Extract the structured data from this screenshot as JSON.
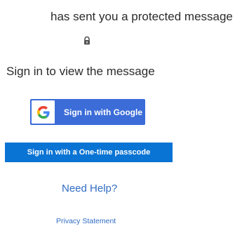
{
  "header": {
    "message": "has sent you a protected message",
    "lock_icon": "lock-icon"
  },
  "main": {
    "heading": "Sign in to view the message",
    "google_button": {
      "label": "Sign in with Google",
      "icon": "google-logo-icon"
    },
    "otp_button": {
      "label": "Sign in with a One-time passcode"
    },
    "need_help_label": "Need Help?",
    "privacy_label": "Privacy Statement"
  },
  "colors": {
    "google_blue": "#3b6cd8",
    "otp_blue": "#0a74d4",
    "link_blue": "#2f6cc4",
    "text": "#2b2b2b"
  }
}
